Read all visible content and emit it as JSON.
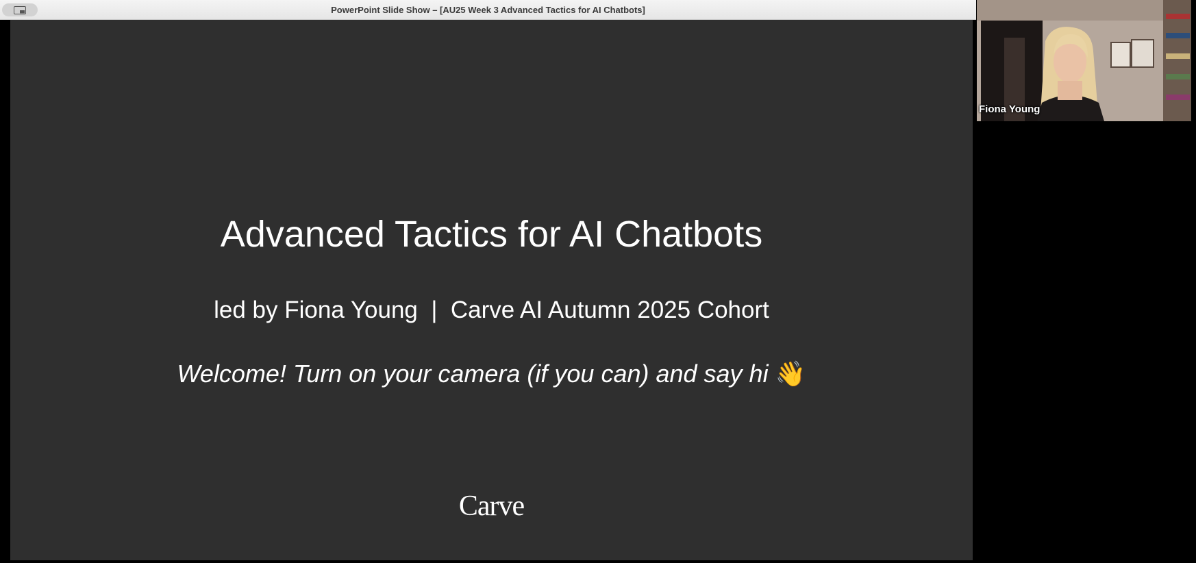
{
  "window": {
    "title": "PowerPoint Slide Show – [AU25 Week 3 Advanced Tactics for AI Chatbots]",
    "sidebar_toggle_icon": "sidebar-toggle-icon"
  },
  "slide": {
    "title": "Advanced Tactics for AI Chatbots",
    "subtitle": "led by Fiona Young  |  Carve AI Autumn 2025 Cohort",
    "welcome": "Welcome! Turn on your camera (if you can) and say hi",
    "wave_emoji": "👋",
    "logo_text": "Carve",
    "background_color": "#2f2f2f",
    "text_color": "#ffffff"
  },
  "participant": {
    "name": "Fiona Young"
  }
}
